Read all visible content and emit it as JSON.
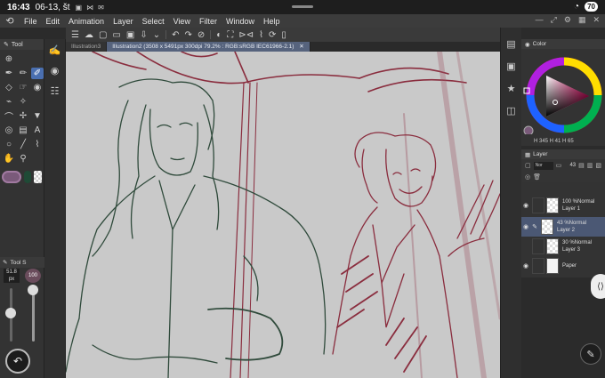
{
  "status_bar": {
    "time": "16:43",
    "date": "06-13, št",
    "battery": "70"
  },
  "menu": {
    "items": [
      "File",
      "Edit",
      "Animation",
      "Layer",
      "Select",
      "View",
      "Filter",
      "Window",
      "Help"
    ]
  },
  "tabs": [
    {
      "label": "Illustration3",
      "active": false
    },
    {
      "label": "Illustration2 (3508 x 5491px 300dpi 79.2% : RGB:sRGB IEC61966-2.1)",
      "active": true
    }
  ],
  "tool_panel": {
    "title": "Tool",
    "sub_title": "Tool S",
    "brush_size": "51.8",
    "brush_size_unit": "px",
    "opacity": "100"
  },
  "color_panel": {
    "title": "Color",
    "hsv_readout": "H 345  H 41  H 65"
  },
  "layer_panel": {
    "title": "Layer",
    "blend_mode": "Nor",
    "opacity": "43",
    "layers": [
      {
        "opacity_mode": "100 %Normal",
        "name": "Layer 1",
        "selected": false,
        "paper": false
      },
      {
        "opacity_mode": "43 %Normal",
        "name": "Layer 2",
        "selected": true,
        "paper": false
      },
      {
        "opacity_mode": "30 %Normal",
        "name": "Layer 3",
        "selected": false,
        "paper": false
      },
      {
        "opacity_mode": "",
        "name": "Paper",
        "selected": false,
        "paper": true
      }
    ]
  },
  "colors": {
    "main": "#7a5a7a",
    "sub": "#1f4a36",
    "sketch_green": "#2f4a3b",
    "sketch_red": "#8a2d3e",
    "canvas_bg": "#c9c9c9"
  }
}
